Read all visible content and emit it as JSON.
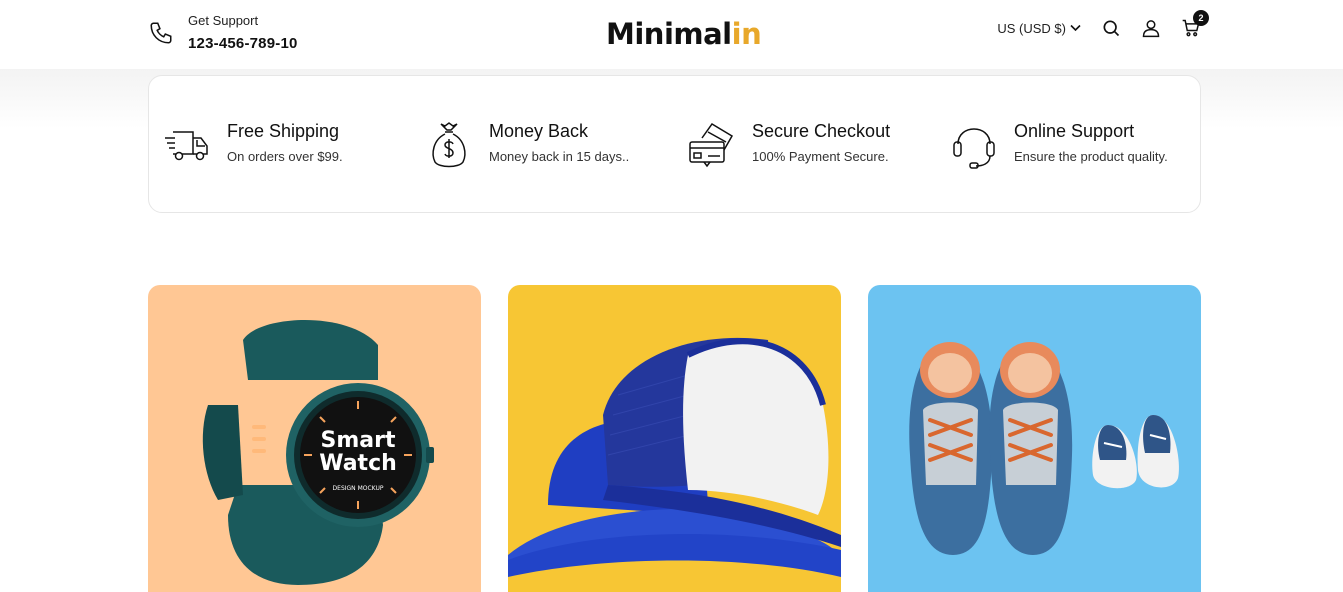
{
  "header": {
    "support_label": "Get Support",
    "support_number": "123-456-789-10",
    "logo_main": "Minimal",
    "logo_accent": "in",
    "currency": "US (USD $)",
    "cart_count": "2"
  },
  "features": [
    {
      "title": "Free Shipping",
      "desc": "On orders over $99.",
      "icon": "delivery-truck-icon"
    },
    {
      "title": "Money Back",
      "desc": "Money back in 15 days..",
      "icon": "money-bag-icon"
    },
    {
      "title": "Secure Checkout",
      "desc": "100% Payment Secure.",
      "icon": "credit-card-icon"
    },
    {
      "title": "Online Support",
      "desc": "Ensure the product quality.",
      "icon": "headset-icon"
    }
  ],
  "products": [
    {
      "name": "smart-watch",
      "bg": "#ffc794",
      "screen_line1": "Smart",
      "screen_line2": "Watch",
      "screen_caption": "DESIGN MOCKUP"
    },
    {
      "name": "caps",
      "bg": "#f7c634"
    },
    {
      "name": "shoes",
      "bg": "#6cc3f1"
    }
  ],
  "colors": {
    "accent": "#e8a82a",
    "text": "#111111",
    "border": "#e6e6e6"
  }
}
